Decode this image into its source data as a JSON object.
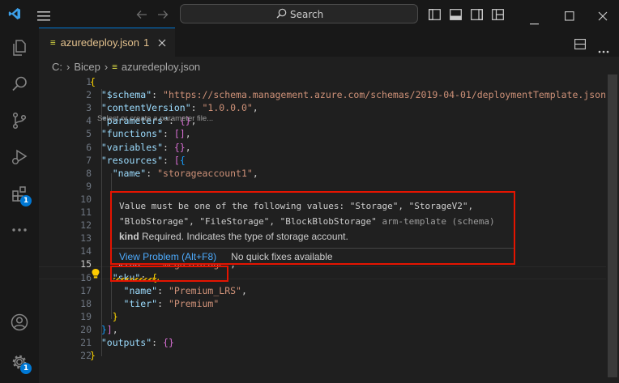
{
  "search": {
    "label": "Search"
  },
  "activity_bar": {
    "items": [
      {
        "name": "explorer",
        "icon": "files-icon"
      },
      {
        "name": "search",
        "icon": "search-icon"
      },
      {
        "name": "source-control",
        "icon": "source-control-icon"
      },
      {
        "name": "run-debug",
        "icon": "run-debug-icon"
      },
      {
        "name": "extensions",
        "icon": "extensions-icon",
        "badge": "1"
      },
      {
        "name": "more",
        "icon": "ellipsis-icon"
      },
      {
        "name": "accounts",
        "icon": "account-icon"
      },
      {
        "name": "manage",
        "icon": "gear-icon",
        "badge": "1"
      }
    ]
  },
  "tab": {
    "label": "azuredeploy.json",
    "problems": "1"
  },
  "breadcrumb": {
    "drive": "C:",
    "folder": "Bicep",
    "file": "azuredeploy.json"
  },
  "editor": {
    "active_line": 15,
    "lines": [
      {
        "n": "1",
        "tokens": [
          [
            "b1",
            "{"
          ]
        ]
      },
      {
        "n": "2",
        "tokens": [
          [
            "k",
            "  \"$schema\""
          ],
          [
            "p",
            ": "
          ],
          [
            "s",
            "\"https://schema.management.azure.com/schemas/2019-04-01/deploymentTemplate.json#\""
          ],
          [
            "p",
            ","
          ]
        ]
      },
      {
        "n": "3",
        "tokens": [
          [
            "k",
            "  \"contentVersion\""
          ],
          [
            "p",
            ": "
          ],
          [
            "s",
            "\"1.0.0.0\""
          ],
          [
            "p",
            ","
          ]
        ]
      },
      {
        "n": "4",
        "tokens": [
          [
            "k",
            "  \"parameters\""
          ],
          [
            "p",
            ": "
          ],
          [
            "b2",
            "{}"
          ],
          [
            "p",
            ","
          ]
        ]
      },
      {
        "n": "5",
        "tokens": [
          [
            "k",
            "  \"functions\""
          ],
          [
            "p",
            ": "
          ],
          [
            "b2",
            "[]"
          ],
          [
            "p",
            ","
          ]
        ]
      },
      {
        "n": "6",
        "tokens": [
          [
            "k",
            "  \"variables\""
          ],
          [
            "p",
            ": "
          ],
          [
            "b2",
            "{}"
          ],
          [
            "p",
            ","
          ]
        ]
      },
      {
        "n": "7",
        "tokens": [
          [
            "k",
            "  \"resources\""
          ],
          [
            "p",
            ": "
          ],
          [
            "b2",
            "["
          ],
          [
            "b3",
            "{"
          ]
        ]
      },
      {
        "n": "8",
        "tokens": [
          [
            "k",
            "    \"name\""
          ],
          [
            "p",
            ": "
          ],
          [
            "s",
            "\"storageaccount1\""
          ],
          [
            "p",
            ","
          ]
        ]
      },
      {
        "n": "9",
        "tokens": []
      },
      {
        "n": "10",
        "tokens": []
      },
      {
        "n": "11",
        "tokens": []
      },
      {
        "n": "12",
        "tokens": []
      },
      {
        "n": "13",
        "tokens": []
      },
      {
        "n": "14",
        "tokens": []
      },
      {
        "n": "15",
        "tokens": [
          [
            "k",
            "    \"kind\""
          ],
          [
            "p",
            ": "
          ],
          [
            "s",
            "\"megaStorage\""
          ],
          [
            "p",
            ","
          ]
        ]
      },
      {
        "n": "16",
        "tokens": [
          [
            "k",
            "    \"sku\""
          ],
          [
            "p",
            ": "
          ],
          [
            "b1",
            "{"
          ]
        ]
      },
      {
        "n": "17",
        "tokens": [
          [
            "k",
            "      \"name\""
          ],
          [
            "p",
            ": "
          ],
          [
            "s",
            "\"Premium_LRS\""
          ],
          [
            "p",
            ","
          ]
        ]
      },
      {
        "n": "18",
        "tokens": [
          [
            "k",
            "      \"tier\""
          ],
          [
            "p",
            ": "
          ],
          [
            "s",
            "\"Premium\""
          ]
        ]
      },
      {
        "n": "19",
        "tokens": [
          [
            "b1",
            "    }"
          ]
        ]
      },
      {
        "n": "20",
        "tokens": [
          [
            "b3",
            "  }"
          ],
          [
            "b2",
            "]"
          ],
          [
            "p",
            ","
          ]
        ]
      },
      {
        "n": "21",
        "tokens": [
          [
            "k",
            "  \"outputs\""
          ],
          [
            "p",
            ": "
          ],
          [
            "b2",
            "{}"
          ]
        ]
      },
      {
        "n": "22",
        "tokens": [
          [
            "b1",
            "}"
          ]
        ]
      }
    ],
    "codelens_hint": "Select or create a parameter file..."
  },
  "hover": {
    "message": "Value must be one of the following values: \"Storage\", \"StorageV2\", \"BlobStorage\", \"FileStorage\", \"BlockBlobStorage\"",
    "source": "arm-template (schema)",
    "detail_keyword": "kind",
    "detail_text": "Required. Indicates the type of storage account.",
    "view_problem": "View Problem (Alt+F8)",
    "no_quick_fixes": "No quick fixes available"
  },
  "colors": {
    "accent": "#0078d4",
    "highlight_box": "#e51400",
    "link": "#4daafc",
    "modified_tab": "#e2c08d"
  }
}
